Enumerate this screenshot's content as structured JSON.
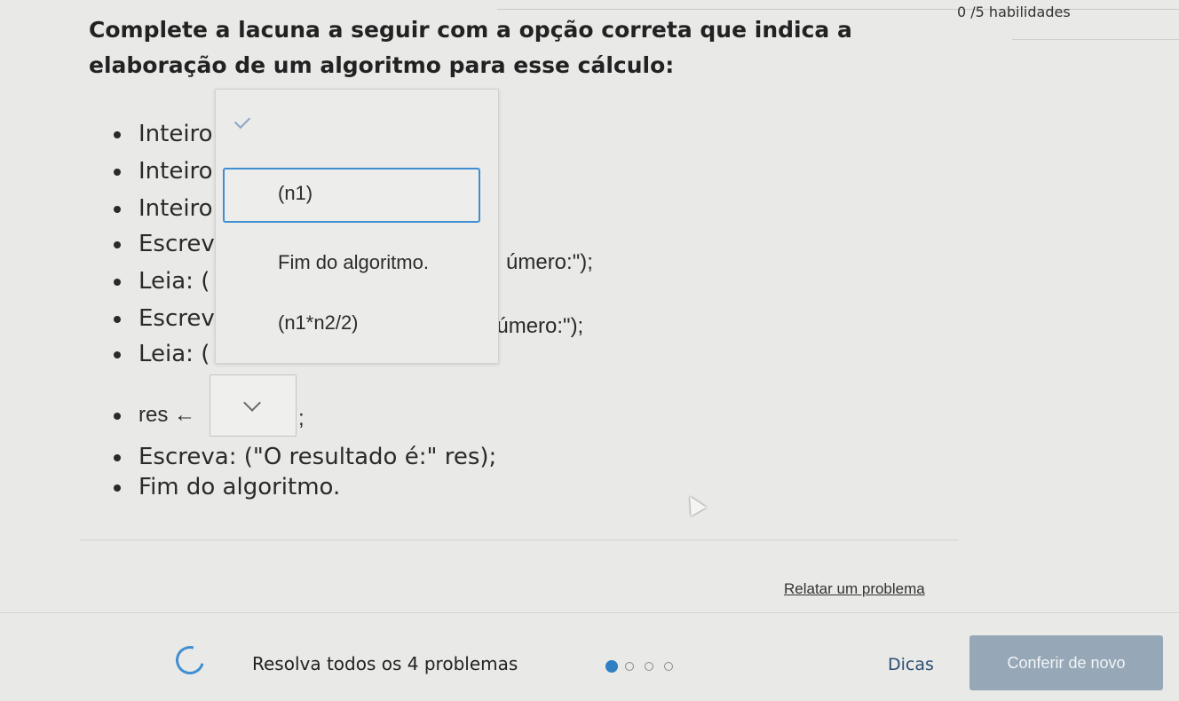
{
  "header": {
    "skills": "0 /5 habilidades"
  },
  "question": "Complete a lacuna a seguir com a opção correta que indica a elaboração de um algoritmo para esse cálculo:",
  "code_lines": [
    {
      "text": "Inteiro"
    },
    {
      "text": "Inteiro"
    },
    {
      "text": "Inteiro"
    },
    {
      "text": "Escrev",
      "tail": "úmero:\");"
    },
    {
      "text": "Leia: ("
    },
    {
      "text": "Escrev",
      "tail": "número:\");"
    },
    {
      "text": "Leia: ("
    }
  ],
  "res_line": {
    "prefix": "res ←",
    "suffix": ";"
  },
  "after_lines": [
    "Escreva: (\"O resultado é:\" res);",
    "Fim do algoritmo."
  ],
  "dropdown": {
    "options": [
      "(n1)",
      "Fim do algoritmo.",
      "(n1*n2/2)"
    ],
    "selected_index": 0
  },
  "links": {
    "report": "Relatar um problema"
  },
  "footer": {
    "progress_text": "Resolva todos os 4 problemas",
    "total": 4,
    "completed": 1,
    "hints": "Dicas",
    "retry": "Conferir de novo"
  },
  "colors": {
    "accent": "#3e8ed0",
    "button": "#96a8b7"
  }
}
